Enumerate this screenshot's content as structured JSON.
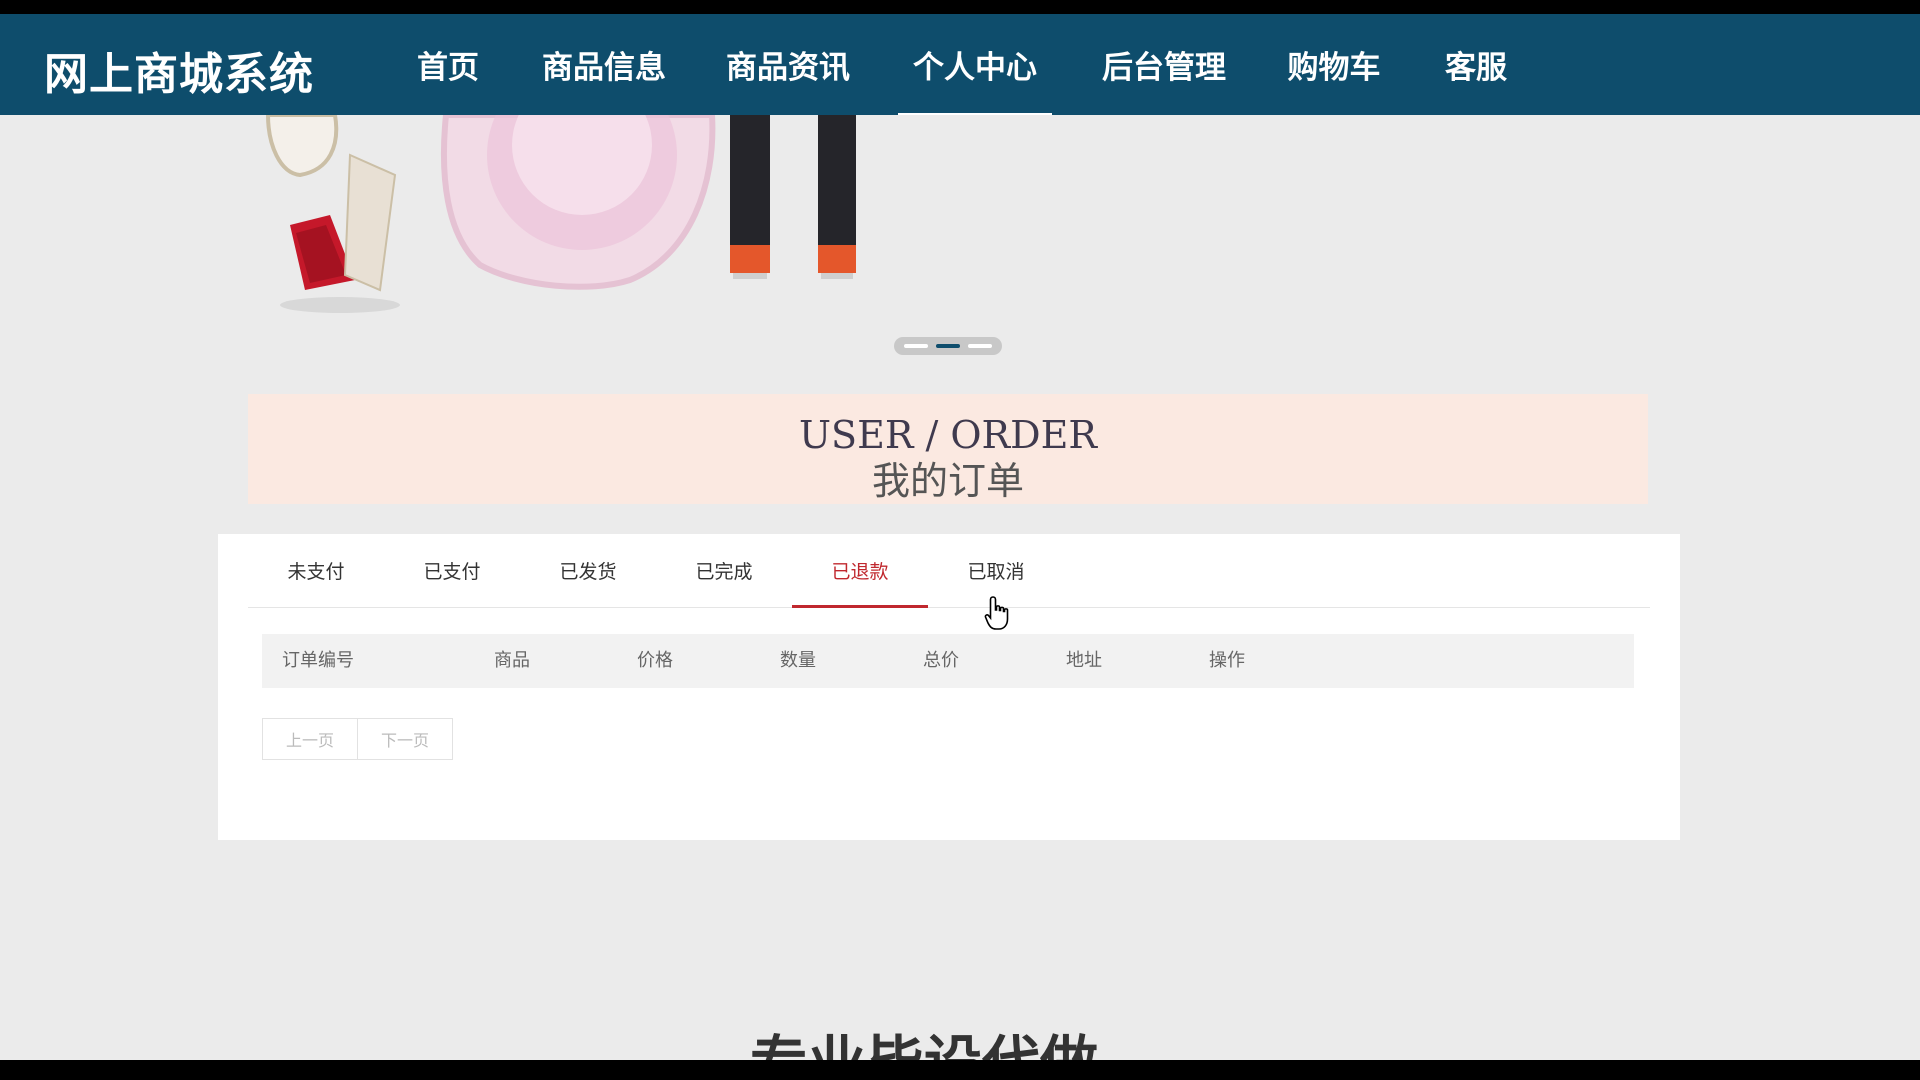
{
  "header": {
    "brand": "网上商城系统",
    "nav": [
      {
        "label": "首页"
      },
      {
        "label": "商品信息"
      },
      {
        "label": "商品资讯"
      },
      {
        "label": "个人中心"
      },
      {
        "label": "后台管理"
      },
      {
        "label": "购物车"
      },
      {
        "label": "客服"
      }
    ],
    "active_index": 3
  },
  "banner": {
    "slide_count": 3,
    "active_slide": 1
  },
  "section": {
    "title_en": "USER / ORDER",
    "title_cn": "我的订单"
  },
  "orders": {
    "tabs": [
      "未支付",
      "已支付",
      "已发货",
      "已完成",
      "已退款",
      "已取消"
    ],
    "active_tab": 4,
    "columns": [
      "订单编号",
      "商品",
      "价格",
      "数量",
      "总价",
      "地址",
      "操作"
    ],
    "rows": [],
    "pager": {
      "prev": "上一页",
      "next": "下一页"
    }
  },
  "caption": "专业毕设代做",
  "colors": {
    "nav_bg": "#0e4d6c",
    "active_tab": "#c0282e",
    "title_band": "#fbe9e1"
  }
}
